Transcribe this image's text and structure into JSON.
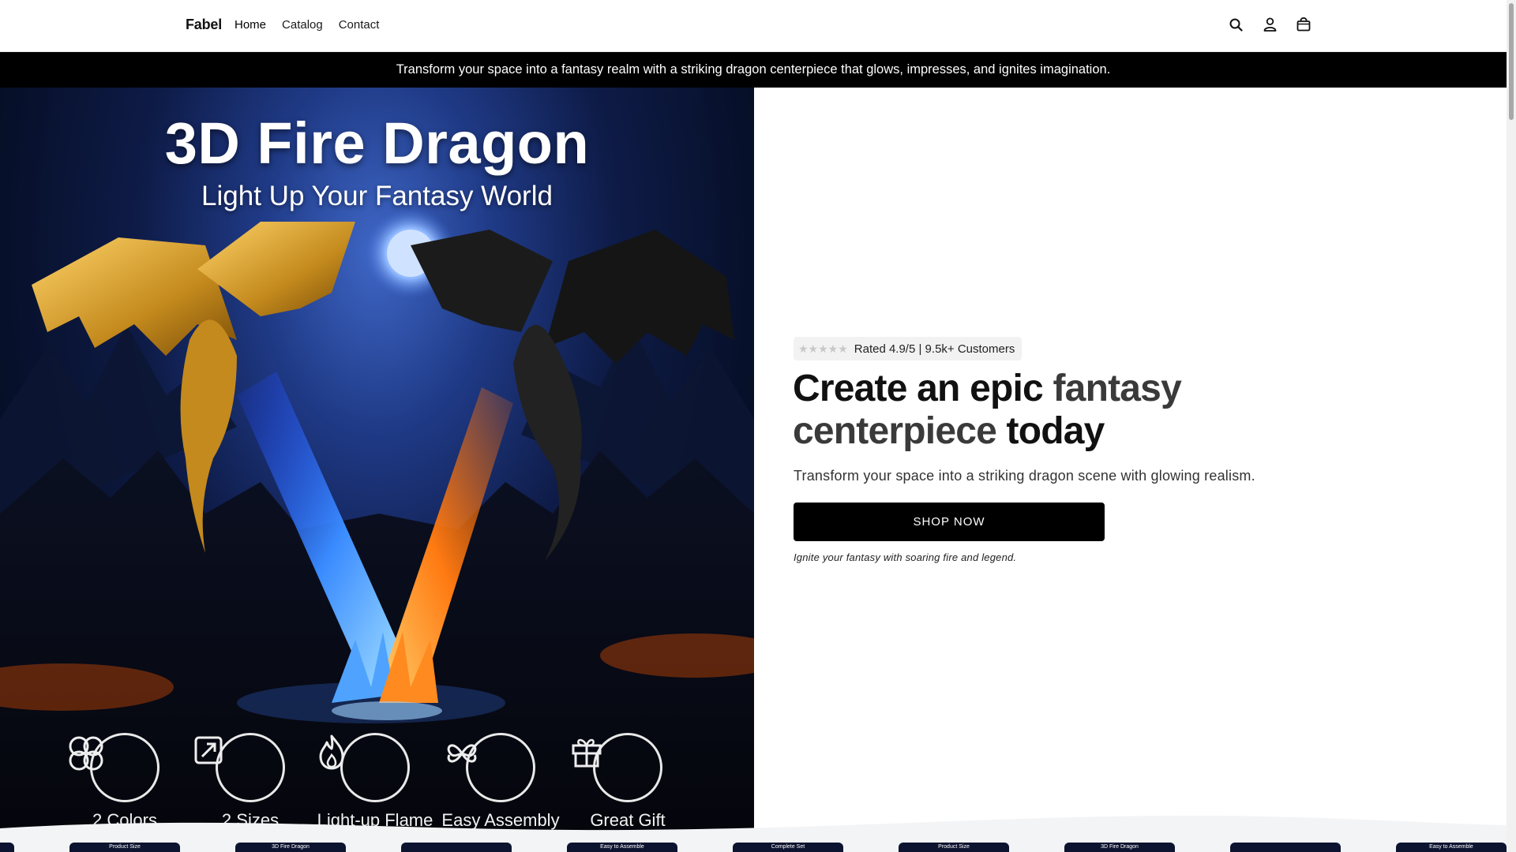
{
  "header": {
    "brand": "Fabel",
    "nav": [
      {
        "label": "Home"
      },
      {
        "label": "Catalog"
      },
      {
        "label": "Contact"
      }
    ],
    "icons": [
      "search-icon",
      "account-icon",
      "cart-icon"
    ]
  },
  "announcement": {
    "text": "Transform your space into a fantasy realm with a striking dragon centerpiece that glows, impresses, and ignites imagination."
  },
  "hero_image": {
    "title": "3D Fire Dragon",
    "subtitle": "Light Up Your Fantasy World",
    "features": [
      {
        "label": "2 Colors",
        "icon": "colors-icon"
      },
      {
        "label": "2 Sizes",
        "icon": "resize-icon"
      },
      {
        "label": "Light-up Flame",
        "icon": "flame-icon"
      },
      {
        "label": "Easy Assembly",
        "icon": "assembly-icon"
      },
      {
        "label": "Great Gift",
        "icon": "gift-icon"
      }
    ]
  },
  "hero": {
    "rating_text": "Rated 4.9/5 | 9.5k+ Customers",
    "stars": "★★★★★",
    "headline_part1": "Create an epic ",
    "headline_accent": "fantasy centerpiece",
    "headline_part2": " today",
    "subtitle": "Transform your space into a striking dragon scene with glowing realism.",
    "cta": "SHOP NOW",
    "tagline": "Ignite your fantasy with soaring fire and legend."
  },
  "thumbnails": [
    {
      "label": ""
    },
    {
      "label": "Product Size"
    },
    {
      "label": "3D Fire Dragon"
    },
    {
      "label": ""
    },
    {
      "label": "Easy to Assemble"
    },
    {
      "label": "Complete Set"
    },
    {
      "label": "Product Size"
    },
    {
      "label": "3D Fire Dragon"
    },
    {
      "label": ""
    },
    {
      "label": "Easy to Assemble"
    }
  ],
  "colors": {
    "accent": "#000000",
    "announcement_bg": "#000000",
    "rating_bg": "#f2f2f2"
  }
}
